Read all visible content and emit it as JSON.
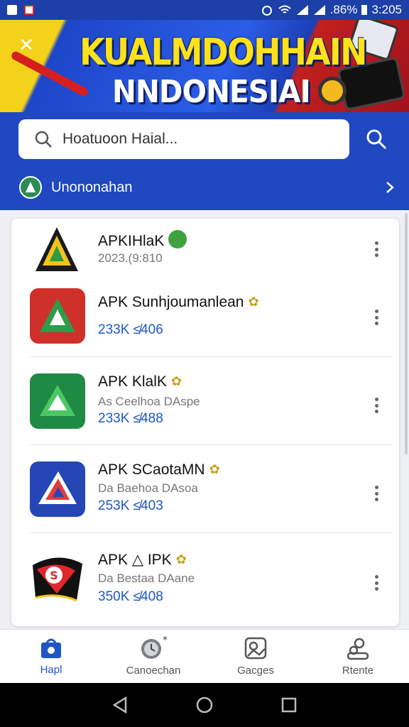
{
  "status_bar": {
    "battery": ".86%",
    "time": "3:205"
  },
  "banner": {
    "title": "KUALMDOHHAIN",
    "subtitle": "NNDONESIAI"
  },
  "search": {
    "placeholder": "Hoatuoon Haial..."
  },
  "header": {
    "sub_label": "Unononahan"
  },
  "apps": [
    {
      "name": "APKIHlaK",
      "meta": "2023.(9:810",
      "size": ""
    },
    {
      "name": "APK Sunhjoumanlean",
      "meta": "",
      "size": "233K ≰406"
    },
    {
      "name": "APK KlalK",
      "meta": "As Ceelhoa DAspe",
      "size": "233K ≰488"
    },
    {
      "name": "APK SCaotaMN",
      "meta": "Da Baehoa DAsoa",
      "size": "253K ≰403"
    },
    {
      "name": "APK △ IPK",
      "meta": "Da Bestaa DAane",
      "size": "350K ≰408"
    }
  ],
  "bottom_nav": [
    {
      "label": "Hapl",
      "icon": "shop-icon"
    },
    {
      "label": "Canoechan",
      "icon": "clock-icon"
    },
    {
      "label": "Gacges",
      "icon": "games-icon"
    },
    {
      "label": "Rtente",
      "icon": "people-icon"
    }
  ],
  "colors": {
    "primary": "#1f48c1",
    "accent": "#1f56c4",
    "banner_yellow": "#ffe21a"
  }
}
